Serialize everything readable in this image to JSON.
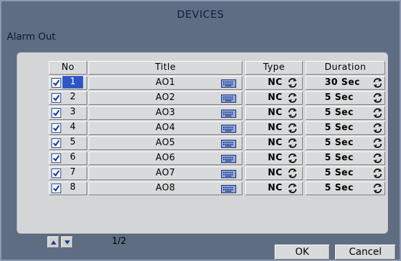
{
  "window": {
    "title": "DEVICES"
  },
  "section": {
    "title": "Alarm Out"
  },
  "table": {
    "headers": {
      "no": "No",
      "title": "Title",
      "type": "Type",
      "duration": "Duration"
    },
    "rows": [
      {
        "no": "1",
        "title": "AO1",
        "type": "NC",
        "duration": "30 Sec",
        "checked": true,
        "selected": true
      },
      {
        "no": "2",
        "title": "AO2",
        "type": "NC",
        "duration": "5 Sec",
        "checked": true,
        "selected": false
      },
      {
        "no": "3",
        "title": "AO3",
        "type": "NC",
        "duration": "5 Sec",
        "checked": true,
        "selected": false
      },
      {
        "no": "4",
        "title": "AO4",
        "type": "NC",
        "duration": "5 Sec",
        "checked": true,
        "selected": false
      },
      {
        "no": "5",
        "title": "AO5",
        "type": "NC",
        "duration": "5 Sec",
        "checked": true,
        "selected": false
      },
      {
        "no": "6",
        "title": "AO6",
        "type": "NC",
        "duration": "5 Sec",
        "checked": true,
        "selected": false
      },
      {
        "no": "7",
        "title": "AO7",
        "type": "NC",
        "duration": "5 Sec",
        "checked": true,
        "selected": false
      },
      {
        "no": "8",
        "title": "AO8",
        "type": "NC",
        "duration": "5 Sec",
        "checked": true,
        "selected": false
      }
    ],
    "icons": {
      "checkbox": "checkbox-checked-icon",
      "keyboard": "keyboard-icon",
      "spin": "cycle-arrows-icon"
    }
  },
  "pagination": {
    "page": "1/2",
    "up_icon": "arrow-up-icon",
    "down_icon": "arrow-down-icon"
  },
  "buttons": {
    "ok": "OK",
    "cancel": "Cancel"
  },
  "colors": {
    "background": "#5f6d83",
    "panel": "#d3d5d6",
    "selection": "#2f56c8",
    "accent": "#1a3aa0"
  }
}
